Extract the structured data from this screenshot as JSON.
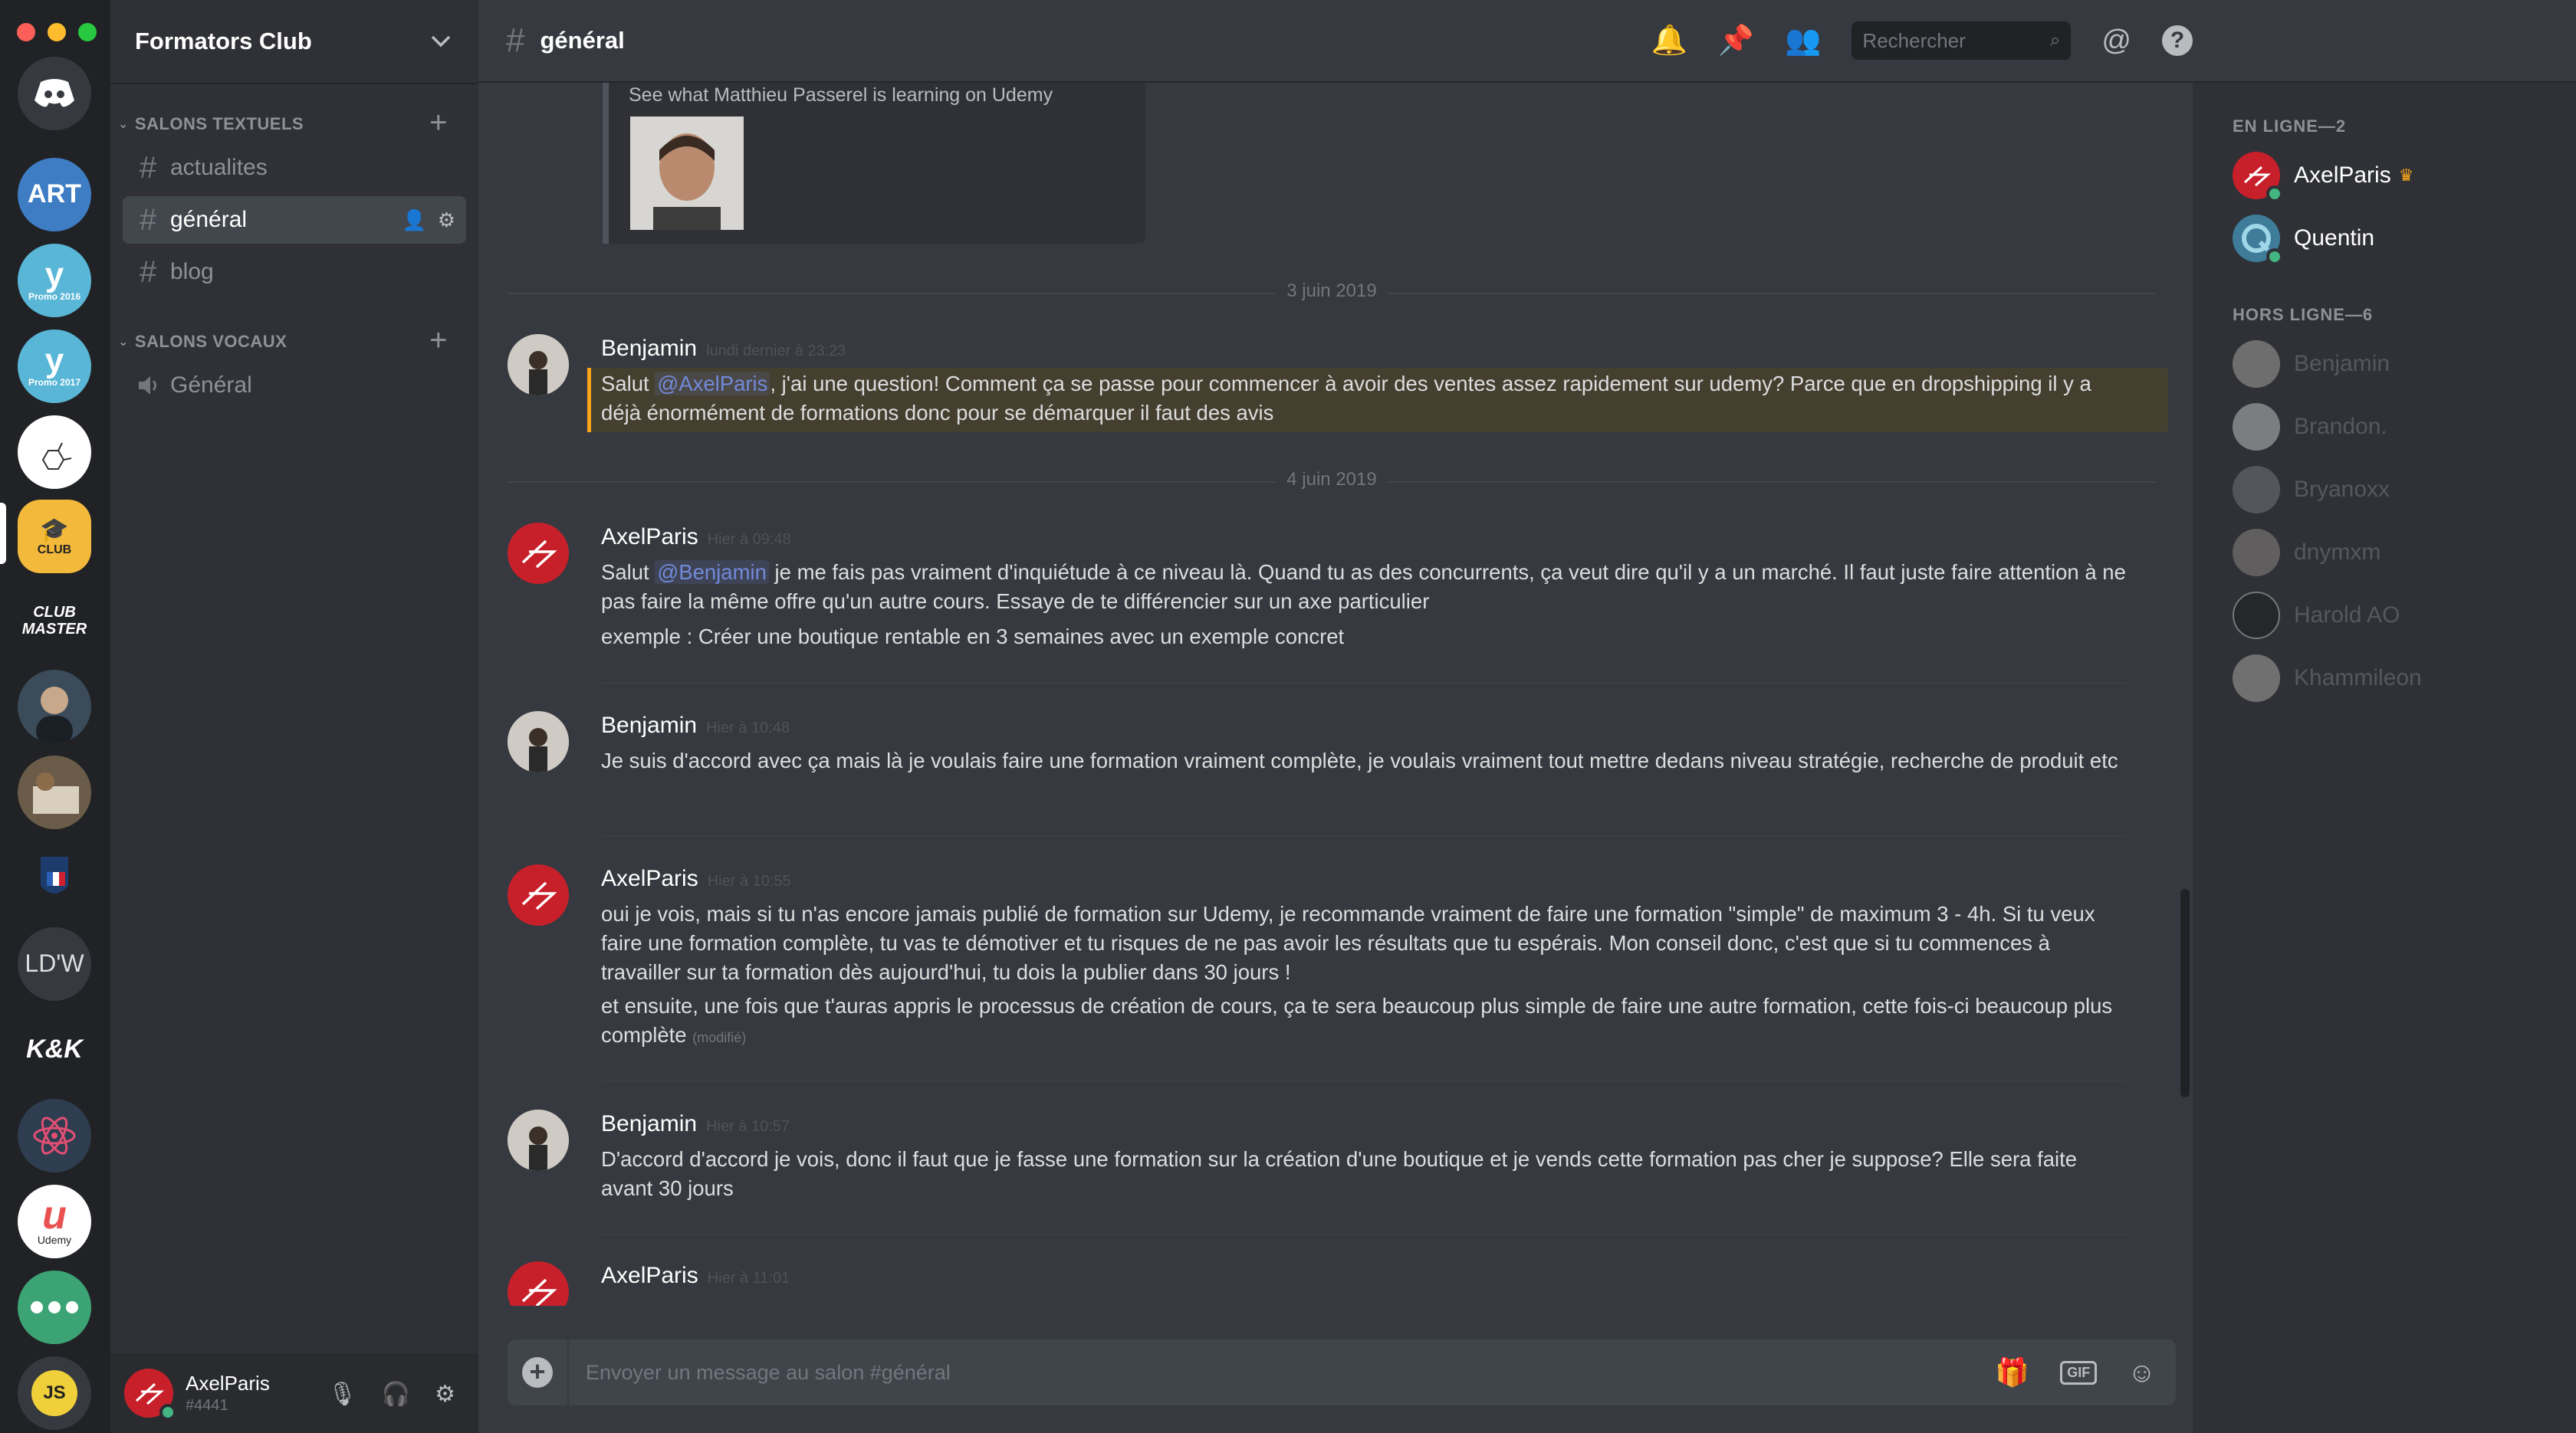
{
  "window": {
    "controls": [
      "#fc5f57",
      "#fdbc2e",
      "#28c840"
    ]
  },
  "guild": {
    "name": "Formators Club"
  },
  "servers": {
    "promo2016": "Promo 2016",
    "promo2017": "Promo 2017",
    "club_label": "CLUB",
    "clubmaster_line1": "CLUB",
    "clubmaster_line2": "MASTER",
    "ldw": "LD'W",
    "kk": "K&K",
    "udemy_label": "Udemy",
    "js": "JS"
  },
  "sidebar": {
    "text_category": "SALONS TEXTUELS",
    "voice_category": "SALONS VOCAUX",
    "channels": [
      {
        "label": "actualites"
      },
      {
        "label": "général"
      },
      {
        "label": "blog"
      }
    ],
    "voice_channels": [
      {
        "label": "Général"
      }
    ]
  },
  "user_panel": {
    "name": "AxelParis",
    "tag": "#4441"
  },
  "header": {
    "channel": "général",
    "search_placeholder": "Rechercher"
  },
  "embed": {
    "description": "See what Matthieu Passerel is learning on Udemy"
  },
  "dividers": [
    "3 juin 2019",
    "4 juin 2019"
  ],
  "messages": [
    {
      "author": "Benjamin",
      "time": "lundi dernier à 23:23",
      "pre": "Salut ",
      "mention": "@AxelParis",
      "post": ", j'ai une question! Comment ça se passe pour commencer à avoir des ventes assez rapidement sur udemy? Parce que en dropshipping il y a déjà énormément de formations donc pour se démarquer il faut des avis"
    },
    {
      "author": "AxelParis",
      "time": "Hier à 09:48",
      "pre": "Salut ",
      "mention": "@Benjamin",
      "post": " je me fais pas vraiment d'inquiétude à ce niveau là. Quand tu as des concurrents, ça veut dire qu'il y a un marché. Il faut juste faire attention à ne pas faire la même offre qu'un autre cours. Essaye de te différencier sur un axe particulier",
      "line2": "exemple : Créer une boutique rentable en 3 semaines avec un exemple concret"
    },
    {
      "author": "Benjamin",
      "time": "Hier à 10:48",
      "text": "Je suis d'accord avec ça mais là je voulais faire une formation vraiment complète, je voulais vraiment tout mettre dedans niveau stratégie, recherche de produit etc"
    },
    {
      "author": "AxelParis",
      "time": "Hier à 10:55",
      "text": "oui je vois, mais si tu n'as encore jamais publié de formation sur Udemy, je recommande vraiment de faire une formation \"simple\" de maximum 3 - 4h. Si tu veux faire une formation complète, tu vas te démotiver et tu risques de ne pas avoir les résultats que tu espérais. Mon conseil donc, c'est que si tu commences à travailler sur ta formation dès aujourd'hui, tu dois la publier dans 30 jours !",
      "line2": "et ensuite, une fois que t'auras appris le processus de création de cours, ça te sera beaucoup plus simple de faire une autre formation, cette fois-ci beaucoup plus complète",
      "edited": "(modifié)"
    },
    {
      "author": "Benjamin",
      "time": "Hier à 10:57",
      "text": "D'accord d'accord je vois, donc il faut que je fasse une formation sur la création d'une boutique et je vends cette formation pas cher je suppose? Elle sera faite avant 30 jours"
    },
    {
      "author": "AxelParis",
      "time": "Hier à 11:01",
      "text": ""
    }
  ],
  "composer": {
    "placeholder": "Envoyer un message au salon #général",
    "gif": "GIF"
  },
  "members": {
    "online_label": "EN LIGNE—2",
    "offline_label": "HORS LIGNE—6",
    "online": [
      "AxelParis",
      "Quentin"
    ],
    "offline": [
      "Benjamin",
      "Brandon.",
      "Bryanoxx",
      "dnymxm",
      "Harold AO",
      "Khammileon"
    ]
  }
}
